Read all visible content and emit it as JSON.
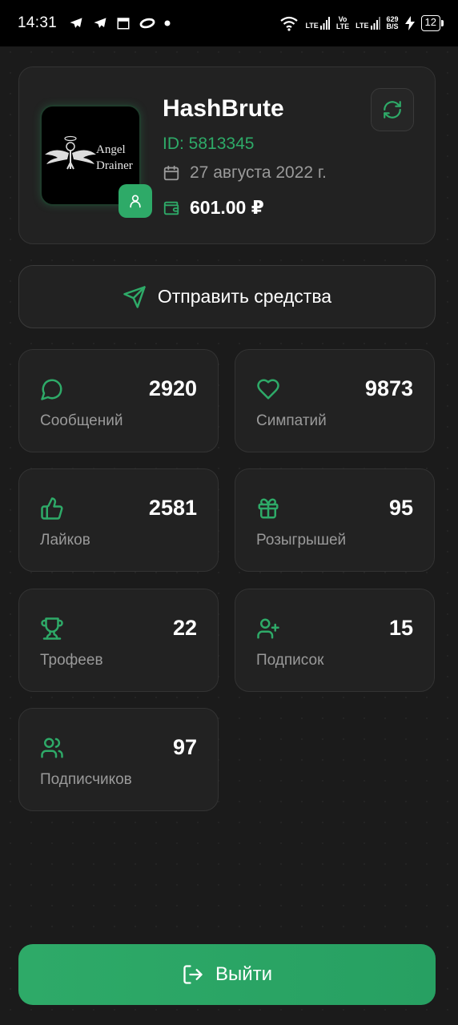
{
  "status_bar": {
    "time": "14:31",
    "network_1": "LTE",
    "network_2_top": "Vo",
    "network_2_bottom": "LTE",
    "network_3": "LTE",
    "speed_value": "629",
    "speed_unit": "B/S",
    "battery": "12"
  },
  "profile": {
    "avatar_text_1": "Angel",
    "avatar_text_2": "Drainer",
    "name": "HashBrute",
    "id": "ID: 5813345",
    "date": "27 августа 2022 г.",
    "balance": "601.00 ₽"
  },
  "send_button": {
    "label": "Отправить средства"
  },
  "stats": [
    {
      "icon": "message-icon",
      "value": "2920",
      "label": "Сообщений"
    },
    {
      "icon": "heart-icon",
      "value": "9873",
      "label": "Симпатий"
    },
    {
      "icon": "thumbs-up-icon",
      "value": "2581",
      "label": "Лайков"
    },
    {
      "icon": "gift-icon",
      "value": "95",
      "label": "Розыгрышей"
    },
    {
      "icon": "trophy-icon",
      "value": "22",
      "label": "Трофеев"
    },
    {
      "icon": "user-plus-icon",
      "value": "15",
      "label": "Подписок"
    },
    {
      "icon": "users-icon",
      "value": "97",
      "label": "Подписчиков"
    }
  ],
  "logout_button": {
    "label": "Выйти"
  },
  "colors": {
    "accent": "#2eaa68",
    "background": "#1b1b1b",
    "card": "#222222",
    "muted_text": "#9a9a9a"
  }
}
